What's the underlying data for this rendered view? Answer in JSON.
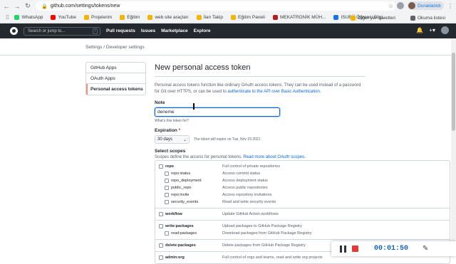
{
  "browser": {
    "url": "github.com/settings/tokens/new",
    "profile_name": "Duraklatıldı",
    "bookmarks": [
      {
        "label": "WhatsApp",
        "color": "#25d366"
      },
      {
        "label": "YouTube",
        "color": "#ff0000"
      },
      {
        "label": "Projelerim",
        "color": "#f4b400"
      },
      {
        "label": "Eğitim",
        "color": "#f4b400"
      },
      {
        "label": "web site araçları",
        "color": "#f4b400"
      },
      {
        "label": "İlan Takip",
        "color": "#f4b400"
      },
      {
        "label": "Eğitim Paneli",
        "color": "#f4b400"
      },
      {
        "label": "MEKATRONİK MÜH...",
        "color": "#b71c1c"
      },
      {
        "label": "ISUBÜ Öğrenci Bilgi...",
        "color": "#1a73e8"
      }
    ],
    "bookmarks_right": [
      "Diğer yer işaretleri",
      "Okuma listesi"
    ]
  },
  "github": {
    "search_placeholder": "Search or jump to...",
    "nav": [
      "Pull requests",
      "Issues",
      "Marketplace",
      "Explore"
    ],
    "plus_label": "+▾"
  },
  "breadcrumb": {
    "settings": "Settings",
    "sep": " / ",
    "developer": "Developer settings"
  },
  "sidebar": [
    {
      "label": "GitHub Apps",
      "selected": false
    },
    {
      "label": "OAuth Apps",
      "selected": false
    },
    {
      "label": "Personal access tokens",
      "selected": true
    }
  ],
  "main": {
    "title": "New personal access token",
    "intro_text": "Personal access tokens function like ordinary OAuth access tokens. They can be used instead of a password for Git over HTTPS, or can be used to ",
    "intro_link": "authenticate to the API over Basic Authentication",
    "intro_end": ".",
    "note_label": "Note",
    "note_value": "deneme",
    "note_hint": "What's this token for?",
    "expiration_label": "Expiration",
    "expiration_required": "*",
    "expiration_value": "30 days",
    "expiration_note": "The token will expire on Tue, Nov 23 2021",
    "scopes_label": "Select scopes",
    "scopes_desc": "Scopes define the access for personal tokens. ",
    "scopes_link": "Read more about OAuth scopes."
  },
  "scopes": [
    {
      "rows": [
        {
          "name": "repo",
          "desc": "Full control of private repositories",
          "top": true
        },
        {
          "name": "repo:status",
          "desc": "Access commit status",
          "top": false
        },
        {
          "name": "repo_deployment",
          "desc": "Access deployment status",
          "top": false
        },
        {
          "name": "public_repo",
          "desc": "Access public repositories",
          "top": false
        },
        {
          "name": "repo:invite",
          "desc": "Access repository invitations",
          "top": false
        },
        {
          "name": "security_events",
          "desc": "Read and write security events",
          "top": false
        }
      ]
    },
    {
      "rows": [
        {
          "name": "workflow",
          "desc": "Update GitHub Action workflows",
          "top": true
        }
      ]
    },
    {
      "rows": [
        {
          "name": "write:packages",
          "desc": "Upload packages to GitHub Package Registry",
          "top": true
        },
        {
          "name": "read:packages",
          "desc": "Download packages from GitHub Package Registry",
          "top": false
        }
      ]
    },
    {
      "rows": [
        {
          "name": "delete:packages",
          "desc": "Delete packages from GitHub Package Registry",
          "top": true
        }
      ]
    },
    {
      "rows": [
        {
          "name": "admin:org",
          "desc": "Full control of orgs and teams, read and write org projects",
          "top": true
        }
      ]
    }
  ],
  "recorder": {
    "time": "00:01:50"
  }
}
